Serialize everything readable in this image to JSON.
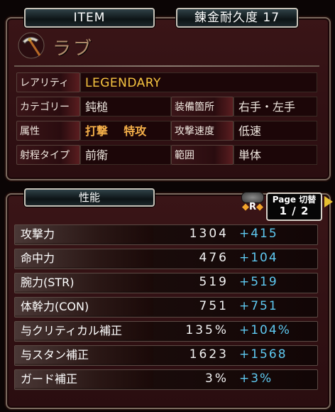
{
  "header": {
    "tab_label": "ITEM",
    "durability_label": "錬金耐久度 17"
  },
  "item": {
    "name": "ラブ",
    "icon": "pickaxe-icon",
    "properties": [
      {
        "label": "レアリティ",
        "value": "LEGENDARY"
      },
      {
        "label": "カテゴリー",
        "value": "鈍槌"
      },
      {
        "label": "装備箇所",
        "value": "右手・左手"
      },
      {
        "label": "属性",
        "value": "打撃",
        "value2": "特攻"
      },
      {
        "label": "攻撃速度",
        "value": "低速"
      },
      {
        "label": "射程タイプ",
        "value": "前衛"
      },
      {
        "label": "範囲",
        "value": "単体"
      }
    ]
  },
  "stats": {
    "tab_label": "性能",
    "r_button": "R",
    "page_toggle_label": "Page 切替",
    "page_indicator": "1 / 2",
    "rows": [
      {
        "label": "攻撃力",
        "base": "1304",
        "bonus": "+415"
      },
      {
        "label": "命中力",
        "base": "476",
        "bonus": "+104"
      },
      {
        "label": "腕力(STR)",
        "base": "519",
        "bonus": "+519"
      },
      {
        "label": "体幹力(CON)",
        "base": "751",
        "bonus": "+751"
      },
      {
        "label": "与クリティカル補正",
        "base": "135%",
        "bonus": "+104%"
      },
      {
        "label": "与スタン補正",
        "base": "1623",
        "bonus": "+1568"
      },
      {
        "label": "ガード補正",
        "base": "3%",
        "bonus": "+3%"
      }
    ]
  },
  "colors": {
    "rarity": "#f6c440",
    "attribute": "#f5b049",
    "bonus": "#5ec9f1",
    "panel": "#2a0d10"
  }
}
